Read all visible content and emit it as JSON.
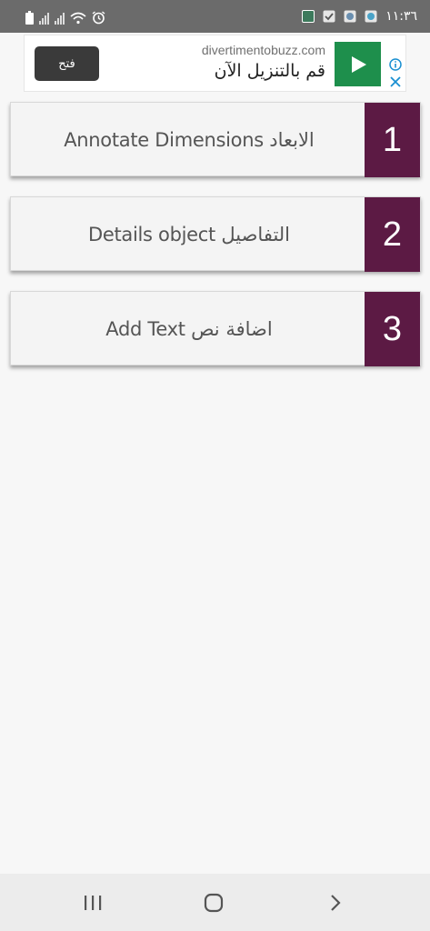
{
  "status_bar": {
    "time": "١١:٣٦",
    "left_icons": [
      "battery-icon",
      "signal-icon",
      "signal-icon",
      "wifi-icon",
      "alarm-icon"
    ],
    "right_icons": [
      "app-notification-icon",
      "check-notification-icon",
      "app-notification-icon",
      "app-notification-icon"
    ]
  },
  "ad": {
    "open_button": "فتح",
    "domain": "divertimentobuzz.com",
    "headline": "قم بالتنزيل الآن",
    "accent_color": "#1e8f4c"
  },
  "menu": {
    "items": [
      {
        "number": "1",
        "label": "Annotate Dimensions الابعاد"
      },
      {
        "number": "2",
        "label": "Details object التفاصيل"
      },
      {
        "number": "3",
        "label": "Add Text اضافة نص"
      }
    ],
    "number_tile_color": "#5c1a44"
  },
  "nav": {
    "buttons": [
      "recent-apps-icon",
      "home-icon",
      "back-icon"
    ]
  }
}
